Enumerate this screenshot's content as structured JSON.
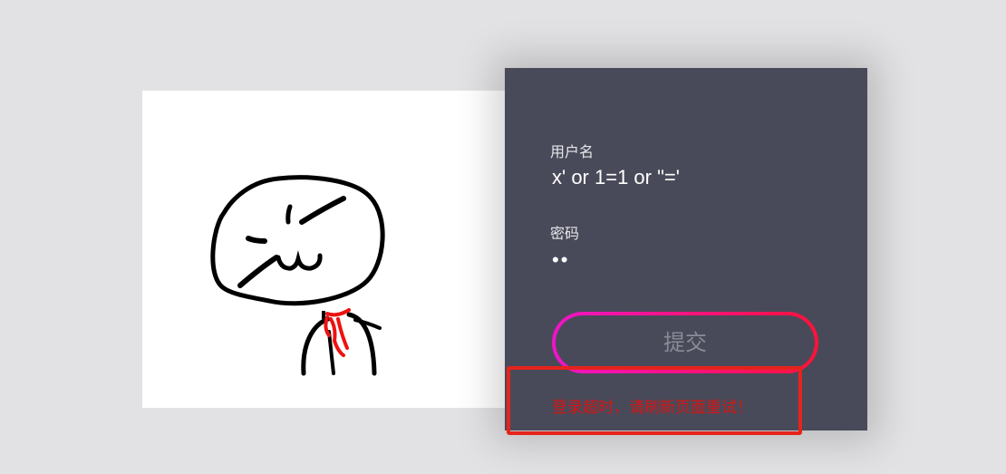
{
  "login_form": {
    "username_label": "用户名",
    "username_value": "x' or 1=1 or \"='",
    "password_label": "密码",
    "password_value": "••",
    "submit_label": "提交",
    "error_message": "登录超时，请刷新页面重试！"
  },
  "illustration": {
    "icon": "smug-stick-figure-meme"
  },
  "colors": {
    "page_background": "#e2e2e4",
    "panel_background": "#494a59",
    "button_gradient_start": "#ef14c9",
    "button_gradient_end": "#ff1239",
    "error_text": "#d61515",
    "error_highlight_border": "#e6231c"
  }
}
